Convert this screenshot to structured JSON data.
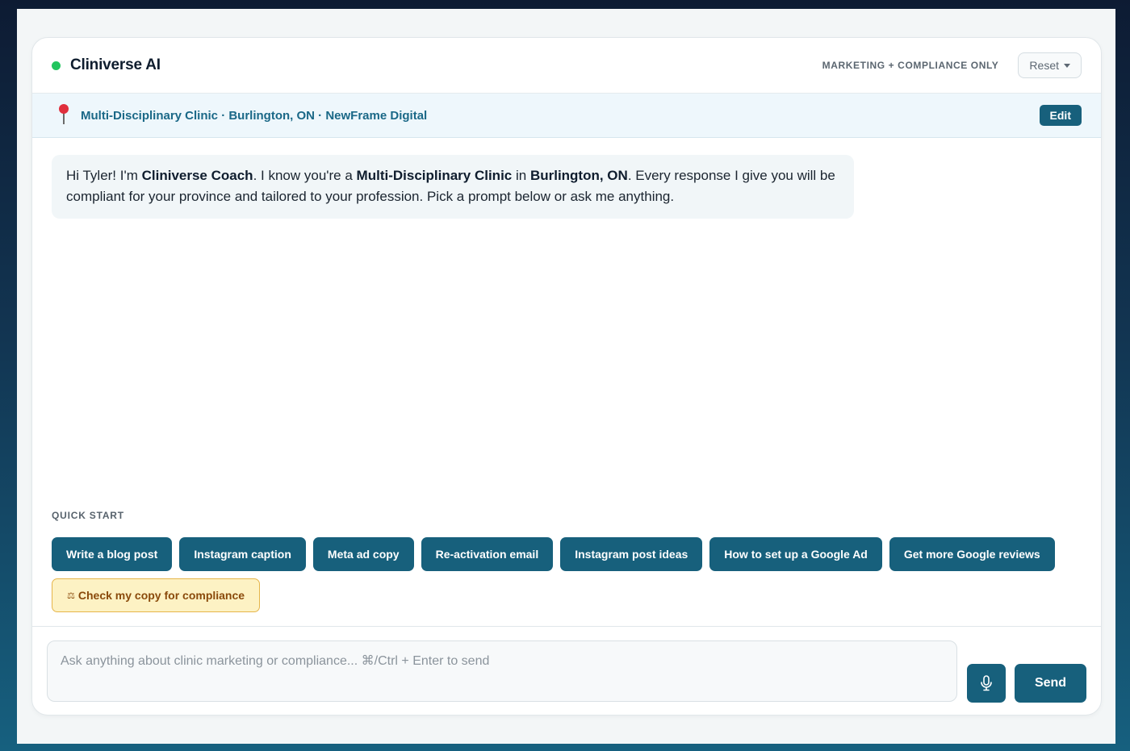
{
  "header": {
    "brand": "Cliniverse AI",
    "status_color": "#22c55e",
    "scope_label": "MARKETING + COMPLIANCE ONLY",
    "reset_label": "Reset"
  },
  "context": {
    "text": "Multi-Disciplinary Clinic · Burlington, ON · NewFrame Digital",
    "edit_label": "Edit"
  },
  "message": {
    "p1": "Hi Tyler! I'm ",
    "b1": "Cliniverse Coach",
    "p2": ". I know you're a ",
    "b2": "Multi-Disciplinary Clinic",
    "p3": " in ",
    "b3": "Burlington, ON",
    "p4": ". Every response I give you will be compliant for your province and tailored to your profession. Pick a prompt below or ask me anything."
  },
  "quick_start": {
    "label": "QUICK START",
    "chips": [
      "Write a blog post",
      "Instagram caption",
      "Meta ad copy",
      "Re-activation email",
      "Instagram post ideas",
      "How to set up a Google Ad",
      "Get more Google reviews"
    ],
    "compliance_chip": "Check my copy for compliance",
    "compliance_icon": "⚖"
  },
  "composer": {
    "placeholder": "Ask anything about clinic marketing or compliance...   ⌘/Ctrl + Enter to send",
    "send_label": "Send"
  },
  "colors": {
    "accent": "#17607c",
    "warn_bg": "#fdf2c4",
    "warn_text": "#8a4a0b"
  }
}
